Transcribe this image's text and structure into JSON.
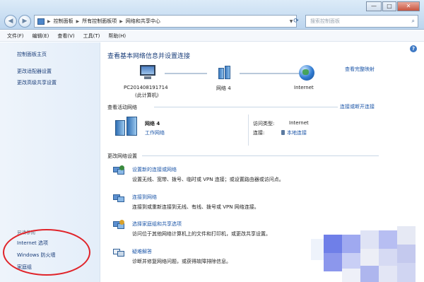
{
  "window": {
    "address": [
      "控制面板",
      "所有控制面板项",
      "网络和共享中心"
    ],
    "search_placeholder": "搜索控制面板",
    "buttons": {
      "minimize": "—",
      "maximize": "□",
      "close": "✕"
    }
  },
  "menu": [
    "文件(F)",
    "编辑(E)",
    "查看(V)",
    "工具(T)",
    "帮助(H)"
  ],
  "sidebar": {
    "home": "控制面板主页",
    "links": [
      "更改适配器设置",
      "更改高级共享设置"
    ],
    "see_also_title": "另请参阅",
    "see_also": [
      "Internet 选项",
      "Windows 防火墙",
      "家庭组"
    ]
  },
  "main": {
    "title": "查看基本网络信息并设置连接",
    "full_map": "查看完整映射",
    "map": {
      "pc_name": "PC201408191714",
      "pc_sub": "(此计算机)",
      "network": "网络  4",
      "internet": "Internet"
    },
    "active": {
      "header": "查看活动网络",
      "connect_link": "连接或断开连接",
      "network_name": "网络  4",
      "network_type": "工作网络",
      "access_label": "访问类型:",
      "access_value": "Internet",
      "connection_label": "连接:",
      "connection_value": "本地连接"
    },
    "change": {
      "header": "更改网络设置",
      "items": [
        {
          "title": "设置新的连接或网络",
          "desc": "设置无线、宽带、拨号、临时或 VPN 连接；或设置路由器或访问点。"
        },
        {
          "title": "连接到网络",
          "desc": "连接到或重新连接到无线、有线、拨号或 VPN 网络连接。"
        },
        {
          "title": "选择家庭组和共享选项",
          "desc": "访问位于其他网络计算机上的文件和打印机，或更改共享设置。"
        },
        {
          "title": "疑难解答",
          "desc": "诊断并修复网络问题，或获得故障排除信息。"
        }
      ]
    }
  },
  "colors": {
    "link": "#1c56a8",
    "title": "#1a3e7a",
    "annotation": "#e0242a"
  }
}
